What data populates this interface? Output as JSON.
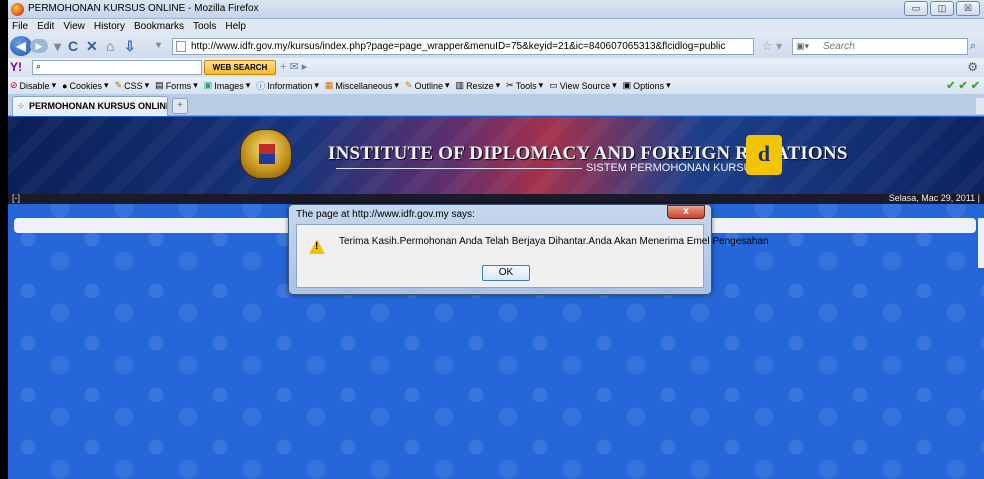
{
  "window": {
    "title": "PERMOHONAN KURSUS ONLINE - Mozilla Firefox",
    "minimize": "▭",
    "maximize": "◫",
    "close": "☒"
  },
  "menu": {
    "file": "File",
    "edit": "Edit",
    "view": "View",
    "history": "History",
    "bookmarks": "Bookmarks",
    "tools": "Tools",
    "help": "Help"
  },
  "nav": {
    "url": "http://www.idfr.gov.my/kursus/index.php?page=page_wrapper&menuID=75&keyid=21&ic=840607065313&flcidlog=public",
    "search_placeholder": "Search"
  },
  "yahoo": {
    "logo": "Y!",
    "search_button": "WEB SEARCH"
  },
  "devbar": {
    "disable": "Disable",
    "cookies": "Cookies",
    "css": "CSS",
    "forms": "Forms",
    "images": "Images",
    "information": "Information",
    "miscellaneous": "Miscellaneous",
    "outline": "Outline",
    "resize": "Resize",
    "tools": "Tools",
    "view_source": "View Source",
    "options": "Options"
  },
  "tab": {
    "label": "PERMOHONAN KURSUS ONLINE",
    "suffix": "&..."
  },
  "page": {
    "institute_title": "INSTITUTE OF DIPLOMACY AND FOREIGN RELATIONS",
    "institute_subtitle": "SISTEM PERMOHONAN KURSUS",
    "bracket": "[-]",
    "date": "Selasa, Mac 29, 2011 |"
  },
  "dialog": {
    "title": "The page at http://www.idfr.gov.my says:",
    "message": "Terima Kasih.Permohonan Anda Telah Berjaya Dihantar.Anda Akan Menerima Emel Pengesahan",
    "ok": "OK",
    "close": "x"
  }
}
